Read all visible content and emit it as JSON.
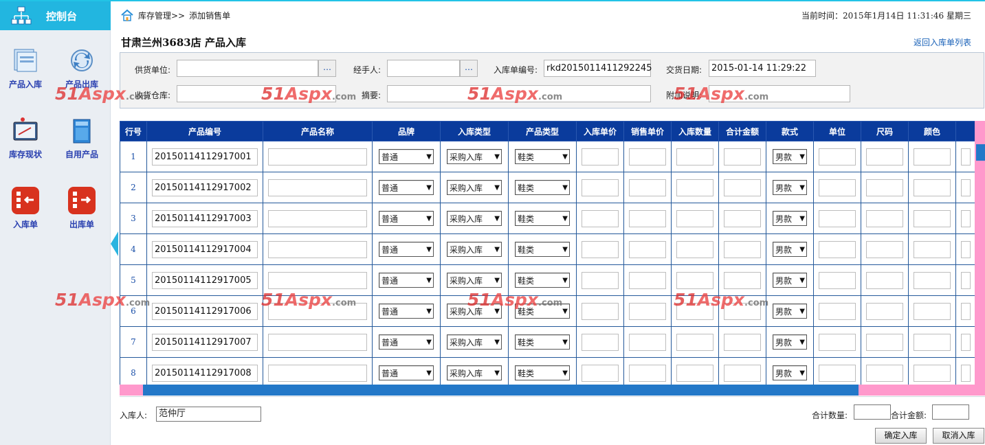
{
  "sidebar": {
    "title": "控制台",
    "items": [
      {
        "label": "产品入库"
      },
      {
        "label": "产品出库"
      },
      {
        "label": "库存现状"
      },
      {
        "label": "自用产品"
      },
      {
        "label": "入库单"
      },
      {
        "label": "出库单"
      }
    ]
  },
  "header": {
    "breadcrumb_parent": "库存管理>>",
    "breadcrumb_current": "添加销售单",
    "time_label": "当前时间：",
    "time_value": "2015年1月14日 11:31:46 星期三"
  },
  "page": {
    "title": "甘肃兰州3683店 产品入库",
    "back_link": "返回入库单列表"
  },
  "form": {
    "supplier_label": "供货单位:",
    "supplier_value": "",
    "pick_symbol": "…",
    "handler_label": "经手人:",
    "handler_value": "",
    "order_no_label": "入库单编号:",
    "order_no_value": "rkd2015011411292245",
    "date_label": "交货日期:",
    "date_value": "2015-01-14 11:29:22",
    "warehouse_label": "收货仓库:",
    "warehouse_value": "",
    "summary_label": "摘要:",
    "summary_value": "",
    "note_label": "附加说明:",
    "note_value": ""
  },
  "grid": {
    "columns": [
      "行号",
      "产品编号",
      "产品名称",
      "品牌",
      "入库类型",
      "产品类型",
      "入库单价",
      "销售单价",
      "入库数量",
      "合计金额",
      "款式",
      "单位",
      "尺码",
      "颜色"
    ],
    "rows": [
      {
        "num": "1",
        "code": "20150114112917001",
        "brand": "普通",
        "in_type": "采购入库",
        "product_type": "鞋类",
        "style": "男款"
      },
      {
        "num": "2",
        "code": "20150114112917002",
        "brand": "普通",
        "in_type": "采购入库",
        "product_type": "鞋类",
        "style": "男款"
      },
      {
        "num": "3",
        "code": "20150114112917003",
        "brand": "普通",
        "in_type": "采购入库",
        "product_type": "鞋类",
        "style": "男款"
      },
      {
        "num": "4",
        "code": "20150114112917004",
        "brand": "普通",
        "in_type": "采购入库",
        "product_type": "鞋类",
        "style": "男款"
      },
      {
        "num": "5",
        "code": "20150114112917005",
        "brand": "普通",
        "in_type": "采购入库",
        "product_type": "鞋类",
        "style": "男款"
      },
      {
        "num": "6",
        "code": "20150114112917006",
        "brand": "普通",
        "in_type": "采购入库",
        "product_type": "鞋类",
        "style": "男款"
      },
      {
        "num": "7",
        "code": "20150114112917007",
        "brand": "普通",
        "in_type": "采购入库",
        "product_type": "鞋类",
        "style": "男款"
      },
      {
        "num": "8",
        "code": "20150114112917008",
        "brand": "普通",
        "in_type": "采购入库",
        "product_type": "鞋类",
        "style": "男款"
      }
    ]
  },
  "footer": {
    "receiver_label": "入库人:",
    "receiver_value": "范仲厅",
    "total_qty_label": "合计数量:",
    "total_qty_value": "",
    "total_amount_label": "合计金额:",
    "total_amount_value": "",
    "confirm_button": "确定入库",
    "cancel_button": "取消入库"
  },
  "watermark": {
    "brand": "51",
    "brand2": "Aspx",
    "domain": ".com"
  },
  "icons": {
    "logo": "org-chart-icon",
    "home": "home-icon",
    "product_in": "product-in-icon",
    "product_out": "product-out-icon",
    "stock_status": "stock-status-icon",
    "self_use": "self-use-icon",
    "in_order": "in-order-icon",
    "out_order": "out-order-icon"
  },
  "colors": {
    "sidebar_header": "#22b6e0",
    "grid_header": "#0a3b9c",
    "scroll_track": "#ff99cc",
    "scroll_thumb": "#2378c8"
  }
}
